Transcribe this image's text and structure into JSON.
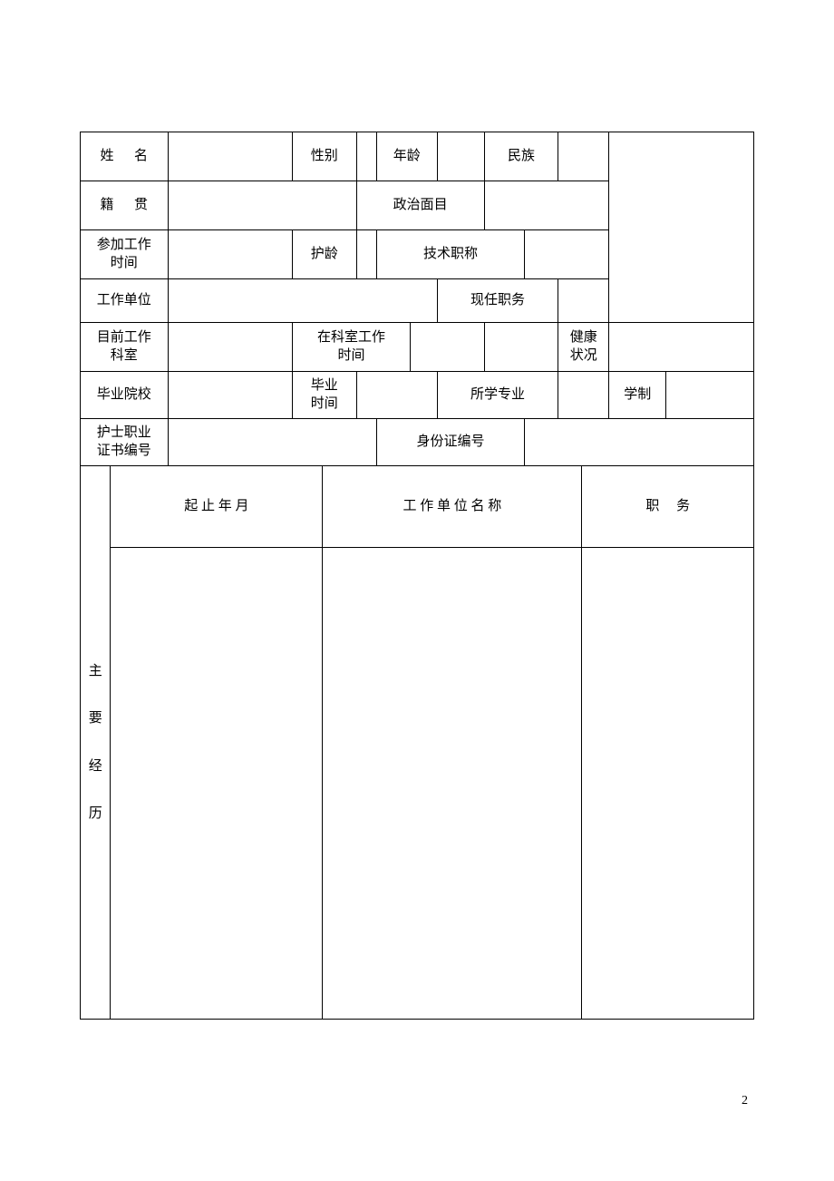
{
  "fields": {
    "name": "姓",
    "name2": "名",
    "gender": "性别",
    "age": "年龄",
    "ethnicity": "民族",
    "native_place": "籍",
    "native_place2": "贯",
    "political_status": "政治面目",
    "work_start_line1": "参加工作",
    "work_start_line2": "时间",
    "nursing_age": "护龄",
    "tech_title": "技术职称",
    "work_unit": "工作单位",
    "current_position": "现任职务",
    "current_dept_line1": "目前工作",
    "current_dept_line2": "科室",
    "dept_time_line1": "在科室工作",
    "dept_time_line2": "时间",
    "health_line1": "健康",
    "health_line2": "状况",
    "grad_school": "毕业院校",
    "grad_time_line1": "毕业",
    "grad_time_line2": "时间",
    "major": "所学专业",
    "edu_system": "学制",
    "nurse_cert_line1": "护士职业",
    "nurse_cert_line2": "证书编号",
    "id_number": "身份证编号"
  },
  "history": {
    "period": "起 止 年 月",
    "org": "工 作 单 位 名 称",
    "position": "职",
    "position2": "务",
    "side_c1": "主",
    "side_c2": "要",
    "side_c3": "经",
    "side_c4": "历"
  },
  "page_number": "2"
}
